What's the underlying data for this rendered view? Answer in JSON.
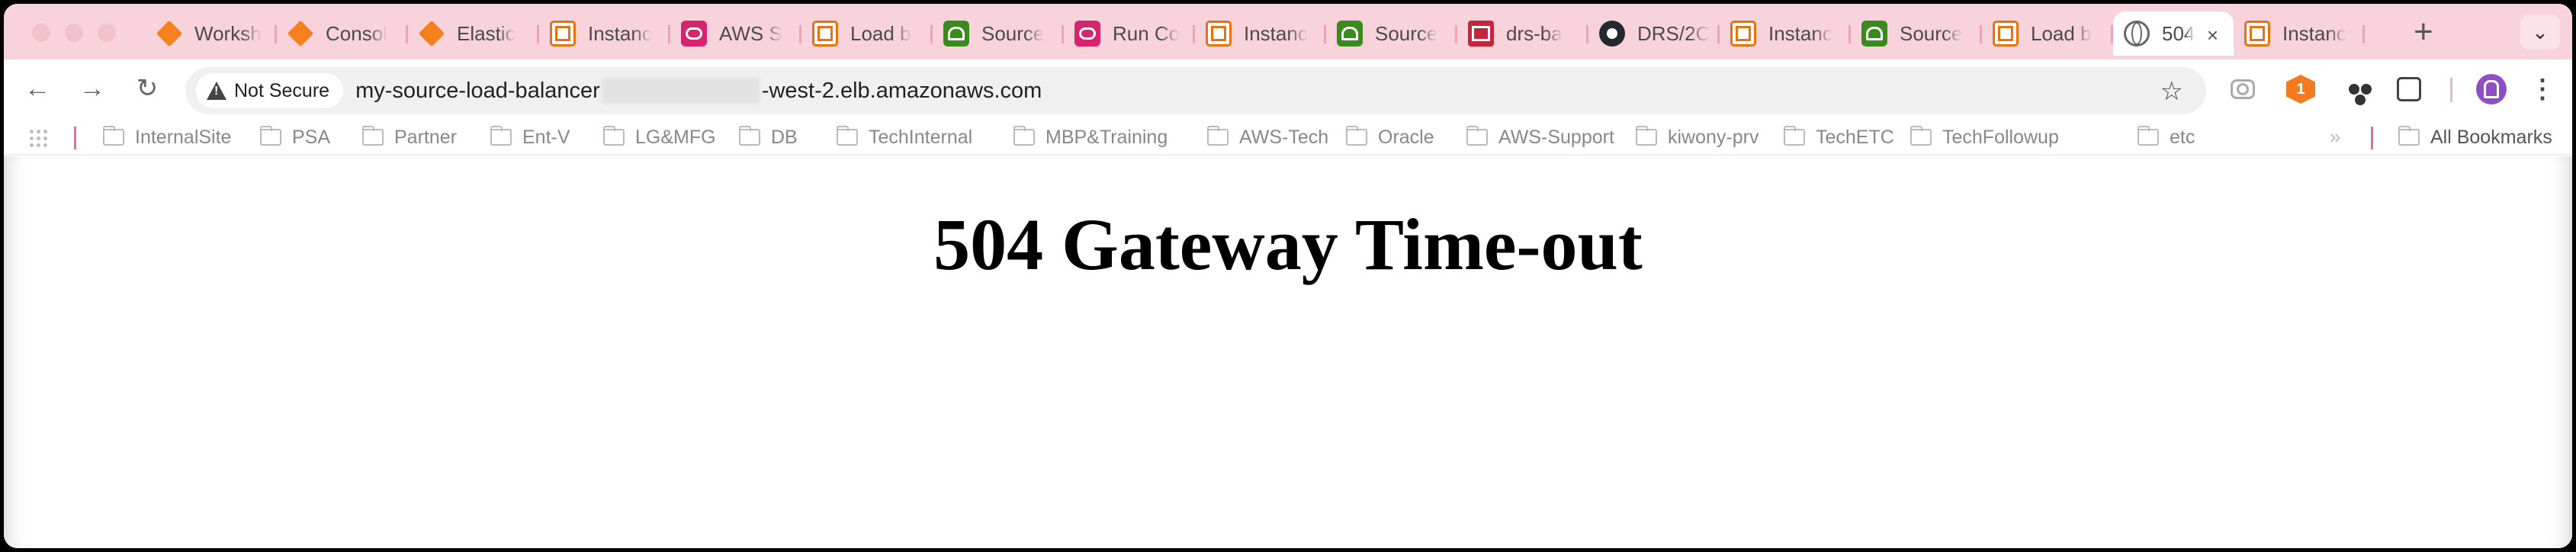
{
  "browser": {
    "tabs": [
      {
        "label": "Worksh",
        "icon": "aws-cube-icon"
      },
      {
        "label": "Consol",
        "icon": "aws-cube-icon"
      },
      {
        "label": "Elastic",
        "icon": "aws-cube-icon"
      },
      {
        "label": "Instanc",
        "icon": "ec2-instance-icon"
      },
      {
        "label": "AWS S",
        "icon": "systems-manager-icon"
      },
      {
        "label": "Load b",
        "icon": "ec2-instance-icon"
      },
      {
        "label": "Source",
        "icon": "drs-icon"
      },
      {
        "label": "Run Co",
        "icon": "systems-manager-icon"
      },
      {
        "label": "Instanc",
        "icon": "ec2-instance-icon"
      },
      {
        "label": "Source",
        "icon": "drs-icon"
      },
      {
        "label": "drs-ba",
        "icon": "bag-icon"
      },
      {
        "label": "DRS/2C",
        "icon": "github-icon"
      },
      {
        "label": "Instanc",
        "icon": "ec2-instance-icon"
      },
      {
        "label": "Source",
        "icon": "drs-icon"
      },
      {
        "label": "Load b",
        "icon": "ec2-instance-icon"
      },
      {
        "label": "504",
        "icon": "globe-icon",
        "active": true
      },
      {
        "label": "Instanc",
        "icon": "ec2-instance-icon"
      }
    ],
    "new_tab_symbol": "+",
    "tab_list_symbol": "⌄"
  },
  "toolbar": {
    "back_symbol": "←",
    "forward_symbol": "→",
    "reload_symbol": "↻",
    "security_label": "Not Secure",
    "url_prefix": "my-source-load-balancer",
    "url_suffix": "-west-2.elb.amazonaws.com",
    "star_symbol": "☆",
    "menu_symbol": "⋮"
  },
  "bookmarks": {
    "items": [
      "InternalSite",
      "PSA",
      "Partner",
      "Ent-V",
      "LG&MFG",
      "DB",
      "TechInternal",
      "MBP&Training",
      "AWS-Tech",
      "Oracle",
      "AWS-Support",
      "kiwony-prv",
      "TechETC",
      "TechFollowup",
      "etc"
    ],
    "more_symbol": "»",
    "all_bookmarks_label": "All Bookmarks"
  },
  "page": {
    "heading": "504 Gateway Time-out"
  }
}
